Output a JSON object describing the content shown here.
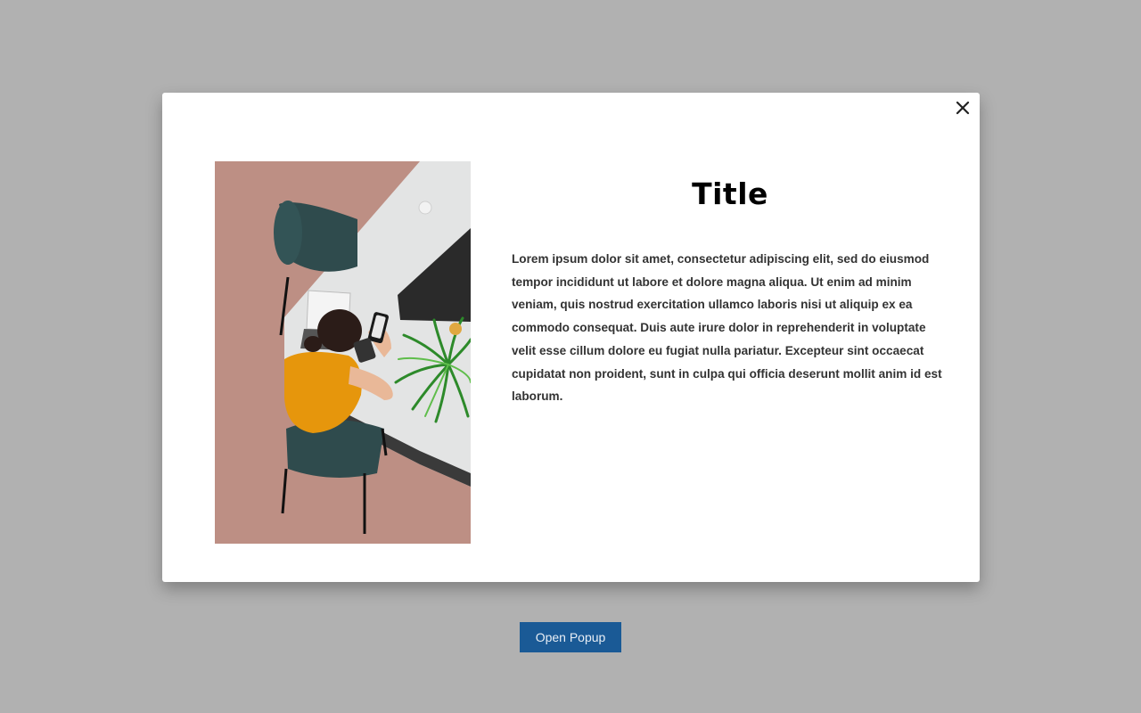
{
  "modal": {
    "title": "Title",
    "body": "Lorem ipsum dolor sit amet, consectetur adipiscing elit, sed do eiusmod tempor incididunt ut labore et dolore magna aliqua. Ut enim ad minim veniam, quis nostrud exercitation ullamco laboris nisi ut aliquip ex ea commodo consequat. Duis aute irure dolor in reprehenderit in voluptate velit esse cillum dolore eu fugiat nulla pariatur. Excepteur sint occaecat cupidatat non proident, sunt in culpa qui officia deserunt mollit anim id est laborum.",
    "close_icon": "close-icon",
    "image": "photo-woman-at-desk"
  },
  "open_button": {
    "label": "Open Popup"
  },
  "colors": {
    "backdrop": "#b1b1b1",
    "modal_bg": "#ffffff",
    "button_bg": "#1a5a96",
    "button_text": "#e8eef5",
    "body_text": "#333333"
  }
}
